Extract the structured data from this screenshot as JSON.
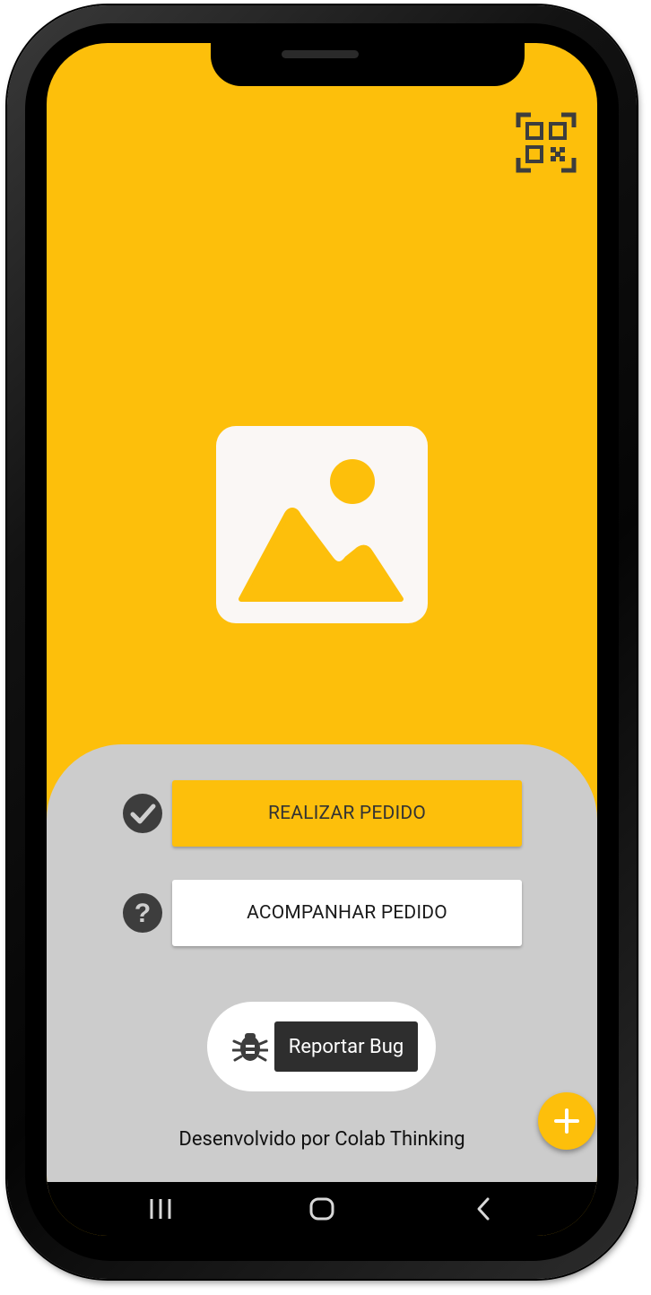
{
  "actions": {
    "order_label": "REALIZAR PEDIDO",
    "track_label": "ACOMPANHAR PEDIDO"
  },
  "bug_report": {
    "label": "Reportar Bug"
  },
  "footer": {
    "credit": "Desenvolvido por Colab Thinking"
  },
  "icons": {
    "top_right": "qr-code-scan-icon",
    "hero": "image-placeholder-icon",
    "order": "check-circle-icon",
    "track": "help-circle-icon",
    "bug": "bug-icon",
    "fab": "plus-icon",
    "nav": [
      "recent-apps-icon",
      "home-icon",
      "back-icon"
    ]
  },
  "colors": {
    "primary": "#FDBF0B",
    "panel": "#CCCCCC",
    "dark": "#2E2E2E",
    "image_bg": "#FAF7F5"
  }
}
